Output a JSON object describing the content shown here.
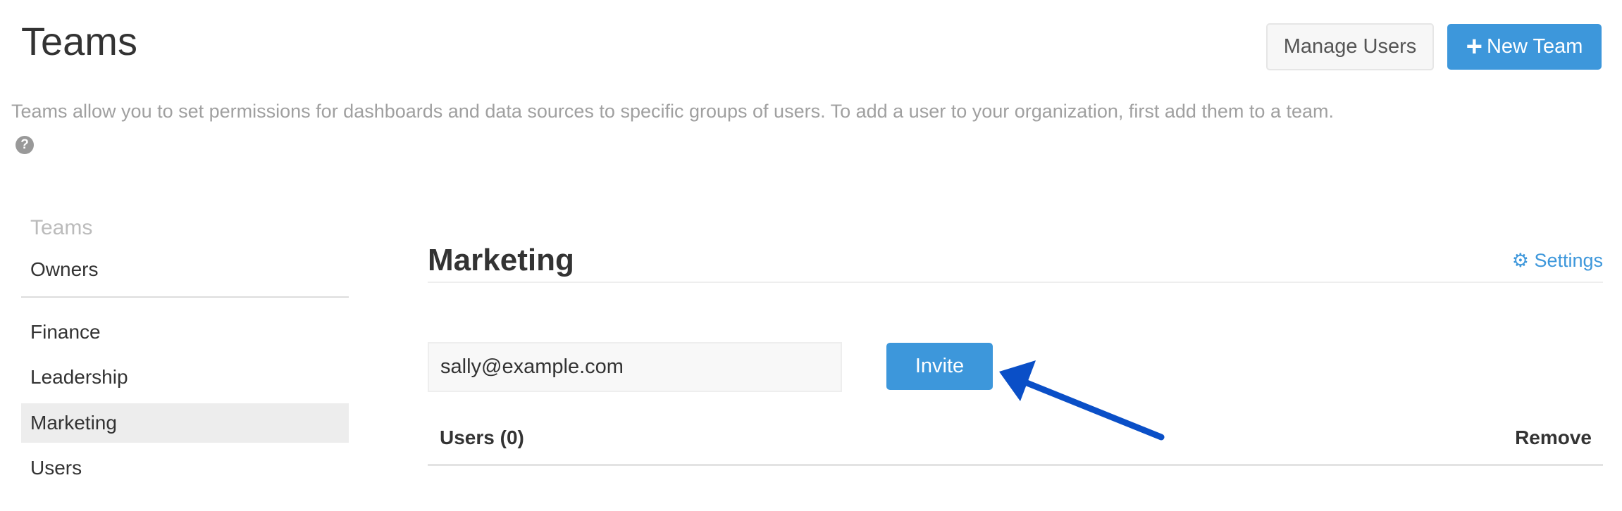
{
  "header": {
    "title": "Teams",
    "manage_users": "Manage Users",
    "new_team": "New Team",
    "new_team_icon": "plus-icon"
  },
  "description": "Teams allow you to set permissions for dashboards and data sources to specific groups of users. To add a user to your organization, first add them to a team.",
  "sidebar": {
    "heading": "Teams",
    "items": [
      {
        "label": "Owners"
      },
      {
        "label": "Finance"
      },
      {
        "label": "Leadership"
      },
      {
        "label": "Marketing",
        "selected": true
      },
      {
        "label": "Users"
      }
    ]
  },
  "main": {
    "title": "Marketing",
    "settings": "Settings",
    "invite_input": "sally@example.com",
    "invite_button": "Invite",
    "users_header": "Users (0)",
    "remove_header": "Remove"
  },
  "colors": {
    "accent": "#3d97db",
    "arrow": "#0a4fc7"
  }
}
